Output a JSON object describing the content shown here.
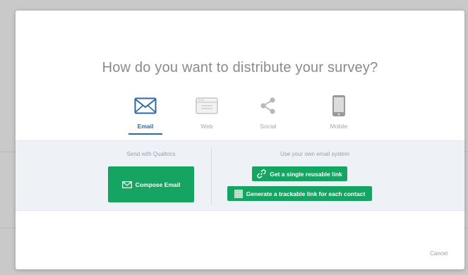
{
  "modal": {
    "title": "How do you want to distribute your survey?",
    "cancel_label": "Cancel"
  },
  "tabs": [
    {
      "label": "Email",
      "icon": "envelope-icon",
      "active": true
    },
    {
      "label": "Web",
      "icon": "browser-window-icon",
      "active": false
    },
    {
      "label": "Social",
      "icon": "share-icon",
      "active": false
    },
    {
      "label": "Mobile",
      "icon": "mobile-phone-icon",
      "active": false
    }
  ],
  "send_with_qualtrics": {
    "heading": "Send with Qualtrics",
    "compose_label": "Compose Email"
  },
  "own_email_system": {
    "heading": "Use your own email system",
    "single_link_label": "Get a single reusable link",
    "trackable_link_label": "Generate a trackable link for each contact"
  },
  "colors": {
    "accent_blue": "#2d6aa3",
    "button_green": "#16a462",
    "panel_bg": "#eef2f7"
  }
}
